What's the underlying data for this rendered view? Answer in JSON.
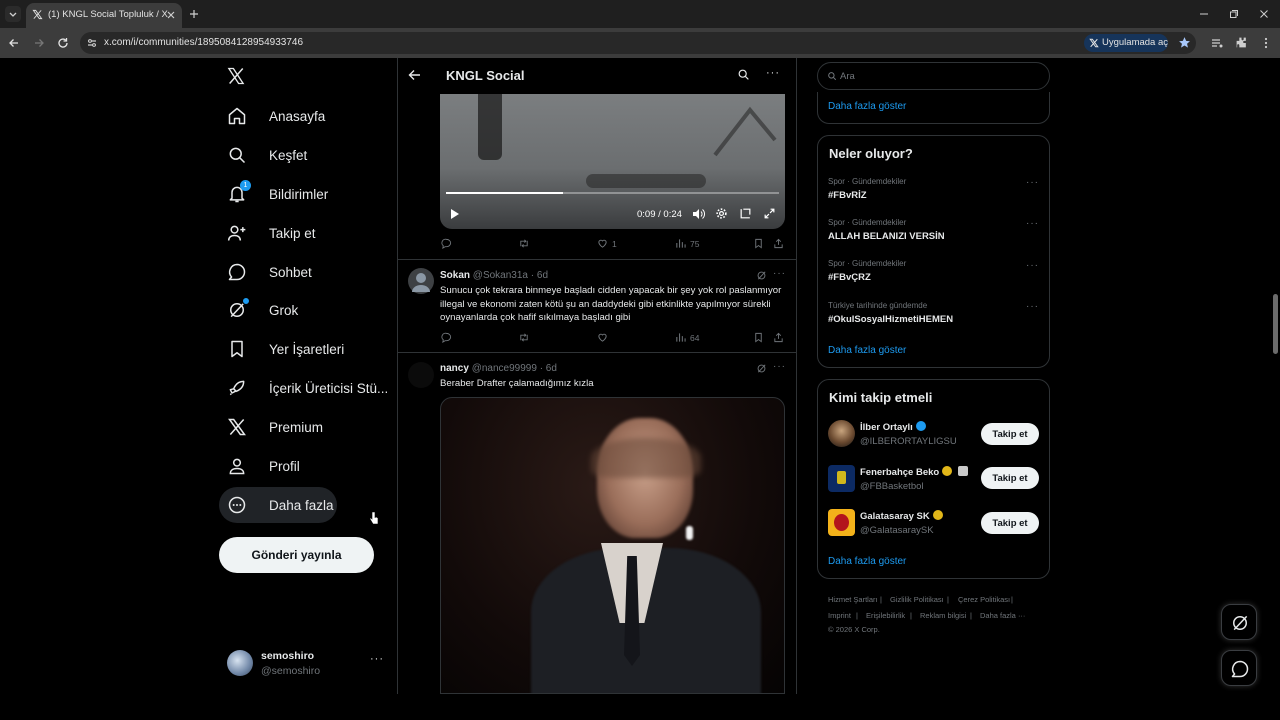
{
  "browser": {
    "tab_title": "(1) KNGL Social Topluluk / X",
    "url": "x.com/i/communities/1895084128954933746",
    "open_in_app_label": "Uygulamada aç"
  },
  "nav": {
    "items": [
      {
        "label": "Anasayfa",
        "icon": "home-icon"
      },
      {
        "label": "Keşfet",
        "icon": "search-icon"
      },
      {
        "label": "Bildirimler",
        "icon": "bell-icon",
        "badge": "1"
      },
      {
        "label": "Takip et",
        "icon": "person-add-icon"
      },
      {
        "label": "Sohbet",
        "icon": "chat-icon"
      },
      {
        "label": "Grok",
        "icon": "grok-icon"
      },
      {
        "label": "Yer İşaretleri",
        "icon": "bookmark-icon"
      },
      {
        "label": "İçerik Üreticisi Stü...",
        "icon": "rocket-icon"
      },
      {
        "label": "Premium",
        "icon": "x-logo-icon"
      },
      {
        "label": "Profil",
        "icon": "person-icon"
      },
      {
        "label": "Daha fazla",
        "icon": "more-circle-icon"
      }
    ],
    "post_button": "Gönderi yayınla",
    "account": {
      "name": "semoshiro",
      "handle": "@semoshiro"
    }
  },
  "header": {
    "title": "KNGL Social"
  },
  "video": {
    "time": "0:09 / 0:24",
    "progress": 0.35
  },
  "post1_actions": {
    "likes": "1",
    "views": "75"
  },
  "post2": {
    "name": "Sokan",
    "handle": "@Sokan31a",
    "time": "· 6d",
    "text": "Sunucu çok tekrara binmeye başladı cidden yapacak bir şey yok rol paslanmıyor illegal ve ekonomi zaten kötü şu an daddydeki gibi etkinlikte yapılmıyor sürekli oynayanlarda çok hafif sıkılmaya başladı gibi",
    "views": "64"
  },
  "post3": {
    "name": "nancy",
    "handle": "@nance99999",
    "time": "· 6d",
    "text": "Beraber Drafter çalamadığımız kızla"
  },
  "search": {
    "placeholder": "Ara"
  },
  "show_more_top": "Daha fazla göster",
  "trends": {
    "title": "Neler oluyor?",
    "items": [
      {
        "context": "Spor · Gündemdekiler",
        "name": "#FBvRİZ"
      },
      {
        "context": "Spor · Gündemdekiler",
        "name": "ALLAH BELANIZI VERSİN"
      },
      {
        "context": "Spor · Gündemdekiler",
        "name": "#FBvÇRZ"
      },
      {
        "context": "Türkiye tarihinde gündemde",
        "name": "#OkulSosyalHizmetiHEMEN"
      }
    ],
    "show_more": "Daha fazla göster"
  },
  "who_to_follow": {
    "title": "Kimi takip etmeli",
    "items": [
      {
        "name": "İlber Ortaylı",
        "handle": "@ILBERORTAYLIGSU",
        "badge_color": "#1d9bf0"
      },
      {
        "name": "Fenerbahçe Beko",
        "handle": "@FBBasketbol",
        "badge_color": "#e2b719"
      },
      {
        "name": "Galatasaray SK",
        "handle": "@GalatasaraySK",
        "badge_color": "#e2b719"
      }
    ],
    "follow_label": "Takip et",
    "show_more": "Daha fazla göster"
  },
  "footer": {
    "links": [
      "Hizmet Şartları",
      "Gizlilik Politikası",
      "Çerez Politikası",
      "Imprint",
      "Erişilebilirlik",
      "Reklam bilgisi",
      "Daha fazla ···"
    ],
    "copyright": "© 2026 X Corp."
  },
  "colors": {
    "accent": "#1d9bf0",
    "background": "#000000",
    "border": "#2f3336",
    "muted": "#71767b"
  }
}
